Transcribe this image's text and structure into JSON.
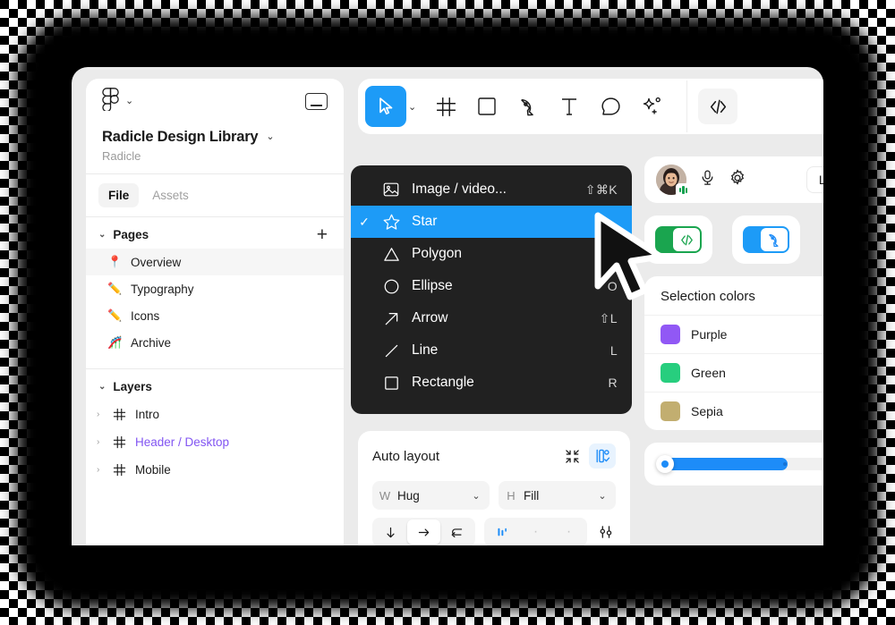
{
  "sidebar": {
    "logo_icon": "figma-logo-icon",
    "logo_caret": "⌄",
    "window_button_icon": "minimize-window-icon",
    "file_name": "Radicle Design Library",
    "file_caret": "⌄",
    "team_name": "Radicle",
    "tabs": [
      {
        "label": "File",
        "active": true
      },
      {
        "label": "Assets",
        "active": false
      }
    ],
    "pages_section": {
      "caret": "⌄",
      "label": "Pages",
      "add_label": "+"
    },
    "pages": [
      {
        "emoji": "📍",
        "label": "Overview",
        "selected": true
      },
      {
        "emoji": "✏️",
        "label": "Typography",
        "selected": false
      },
      {
        "emoji": "✏️",
        "label": "Icons",
        "selected": false
      },
      {
        "emoji": "🎢",
        "label": "Archive",
        "selected": false
      }
    ],
    "layers_section": {
      "caret": "⌄",
      "label": "Layers"
    },
    "layers": [
      {
        "arrow": "›",
        "label": "Intro",
        "purple": false
      },
      {
        "arrow": "›",
        "label": "Header / Desktop",
        "purple": true
      },
      {
        "arrow": "›",
        "label": "Mobile",
        "purple": false
      }
    ]
  },
  "toolbar": {
    "tools": [
      {
        "name": "move-tool",
        "icon": "cursor-arrow-icon",
        "active": true
      },
      {
        "name": "frame-tool",
        "icon": "frame-hash-icon",
        "active": false
      },
      {
        "name": "shape-tool",
        "icon": "square-icon",
        "active": false
      },
      {
        "name": "pen-tool",
        "icon": "pen-nib-icon",
        "active": false
      },
      {
        "name": "text-tool",
        "icon": "text-t-icon",
        "active": false
      },
      {
        "name": "comment-tool",
        "icon": "comment-bubble-icon",
        "active": false
      },
      {
        "name": "actions-tool",
        "icon": "sparkle-plus-icon",
        "active": false
      }
    ],
    "tool_caret": "⌄",
    "dev_mode": {
      "name": "dev-mode-toggle",
      "icon": "code-brackets-icon"
    }
  },
  "menu": {
    "items": [
      {
        "icon": "image-icon",
        "label": "Image / video...",
        "shortcut": "⇧⌘K",
        "checked": false,
        "selected": false
      },
      {
        "icon": "star-icon",
        "label": "Star",
        "shortcut": "",
        "checked": true,
        "selected": true
      },
      {
        "icon": "polygon-icon",
        "label": "Polygon",
        "shortcut": "",
        "checked": false,
        "selected": false
      },
      {
        "icon": "ellipse-icon",
        "label": "Ellipse",
        "shortcut": "O",
        "checked": false,
        "selected": false
      },
      {
        "icon": "arrow-icon",
        "label": "Arrow",
        "shortcut": "⇧L",
        "checked": false,
        "selected": false
      },
      {
        "icon": "line-icon",
        "label": "Line",
        "shortcut": "L",
        "checked": false,
        "selected": false
      },
      {
        "icon": "rectangle-icon",
        "label": "Rectangle",
        "shortcut": "R",
        "checked": false,
        "selected": false
      }
    ],
    "check_glyph": "✓"
  },
  "auto_layout": {
    "title": "Auto layout",
    "collapse_icon": "collapse-arrows-icon",
    "settings_icon": "layout-settings-icon",
    "width": {
      "key": "W",
      "value": "Hug",
      "caret": "⌄"
    },
    "height": {
      "key": "H",
      "value": "Fill",
      "caret": "⌄"
    },
    "direction_icons": [
      "arrow-down-icon",
      "arrow-right-icon",
      "wrap-icon"
    ],
    "direction_active_index": 1,
    "align_icons": [
      "align-distribute-icon",
      "align-dot-icon",
      "align-dot-icon"
    ],
    "align_active_index": 0,
    "advanced_icon": "sliders-icon"
  },
  "presence": {
    "avatar_name": "user-avatar",
    "speaking_badge": "audio-waveform-badge",
    "mic_icon": "microphone-icon",
    "settings_icon": "gear-icon",
    "leave_label": "Leave"
  },
  "toggles": [
    {
      "name": "dev-mode-switch",
      "icon": "code-brackets-icon",
      "color": "#1aa54f",
      "on": true
    },
    {
      "name": "design-mode-switch",
      "icon": "pen-nib-icon",
      "color": "#1d9bf7",
      "on": true
    }
  ],
  "selection_colors": {
    "title": "Selection colors",
    "rows": [
      {
        "label": "Purple",
        "hex": "#9158F5"
      },
      {
        "label": "Green",
        "hex": "#27CE7E"
      },
      {
        "label": "Sepia",
        "hex": "#C2AE70"
      }
    ]
  },
  "slider": {
    "name": "opacity-slider",
    "value_percent": 58,
    "fill_color": "#1d8cf8"
  },
  "cursor": {
    "name": "pointer-cursor"
  }
}
